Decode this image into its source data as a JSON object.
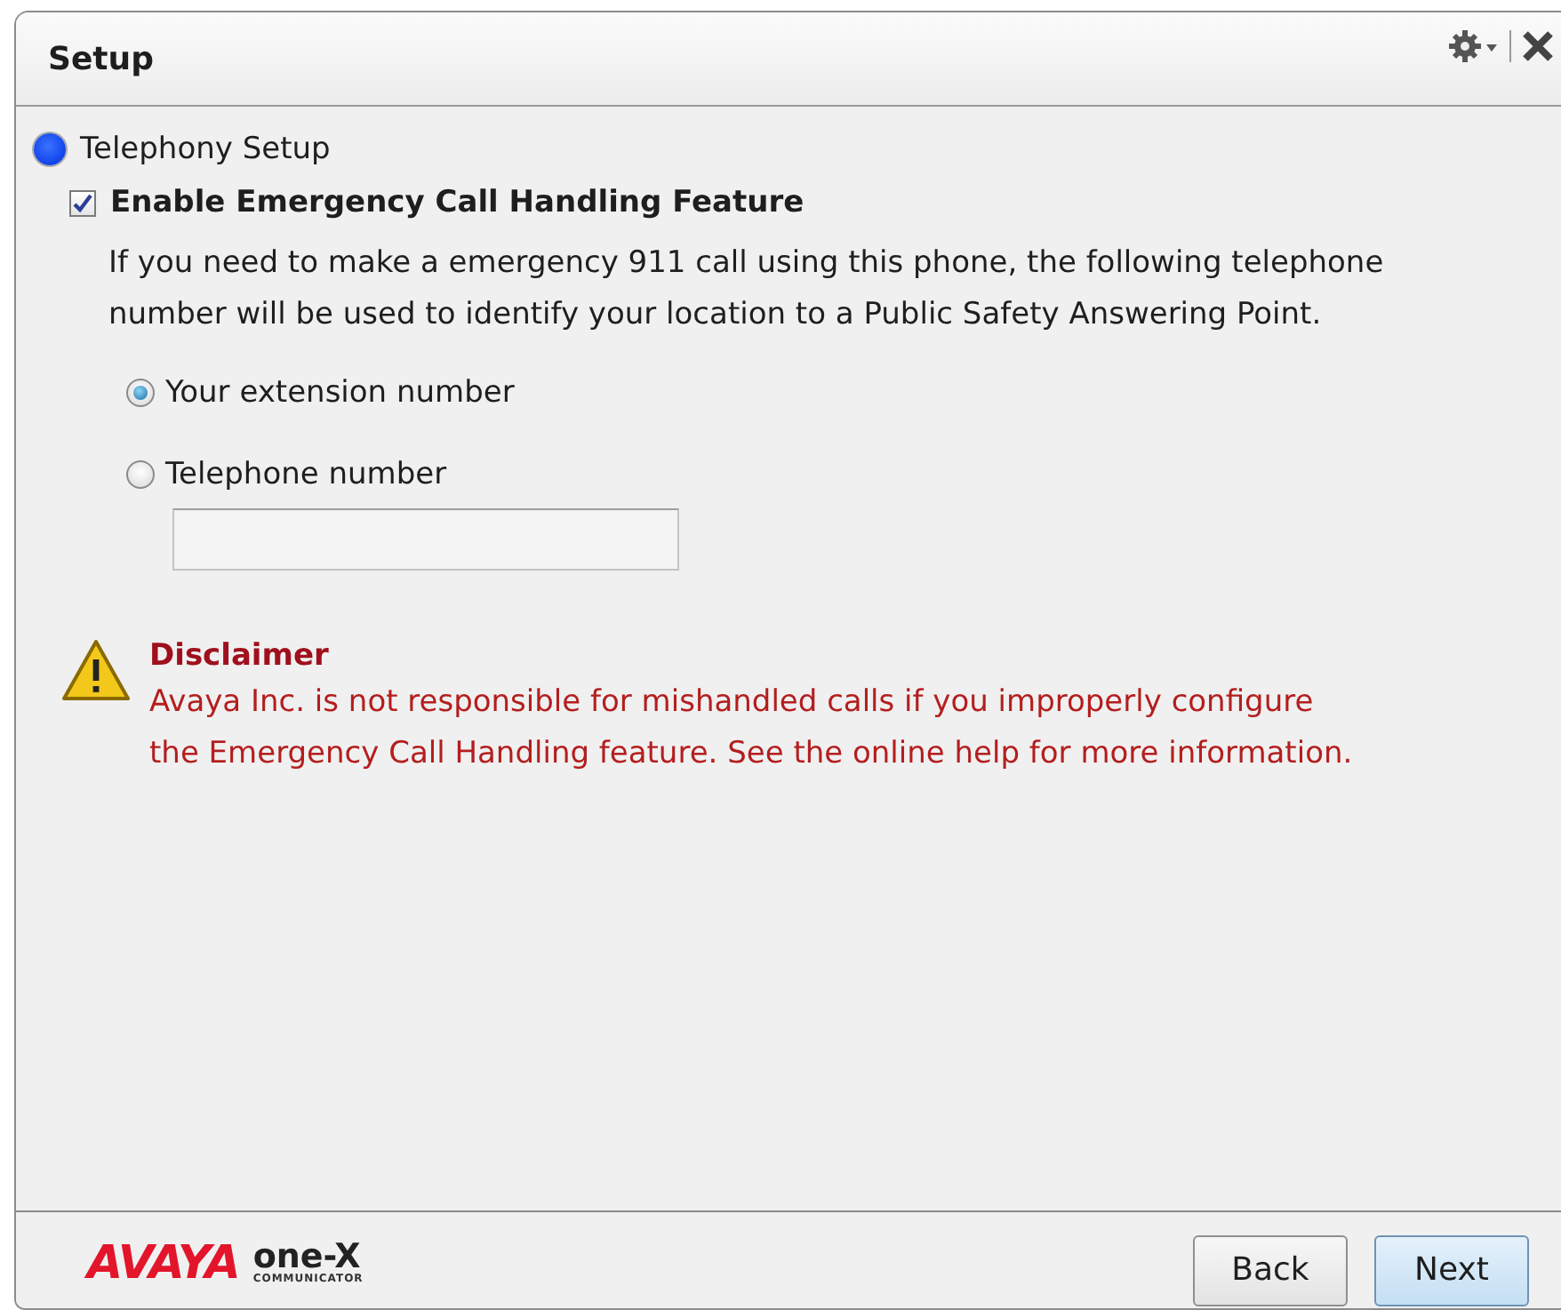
{
  "window": {
    "title": "Setup"
  },
  "section": {
    "label": "Telephony Setup"
  },
  "emergency": {
    "label": "Enable Emergency Call Handling Feature",
    "checked": true,
    "description": "If you need to make a emergency 911 call using this phone, the following telephone number will be used to identify your location to a Public Safety Answering Point.",
    "options": [
      {
        "label": "Your extension number",
        "selected": true
      },
      {
        "label": "Telephone number",
        "selected": false
      }
    ]
  },
  "disclaimer": {
    "title": "Disclaimer",
    "text": "Avaya Inc. is not responsible for mishandled calls if you improperly configure the Emergency Call Handling feature. See the online help for more information."
  },
  "logo": {
    "brand": "AVAYA",
    "product": "one-X",
    "tagline": "COMMUNICATOR"
  },
  "buttons": [
    {
      "label": "Back",
      "kind": "default"
    },
    {
      "label": "Next",
      "kind": "primary"
    }
  ]
}
